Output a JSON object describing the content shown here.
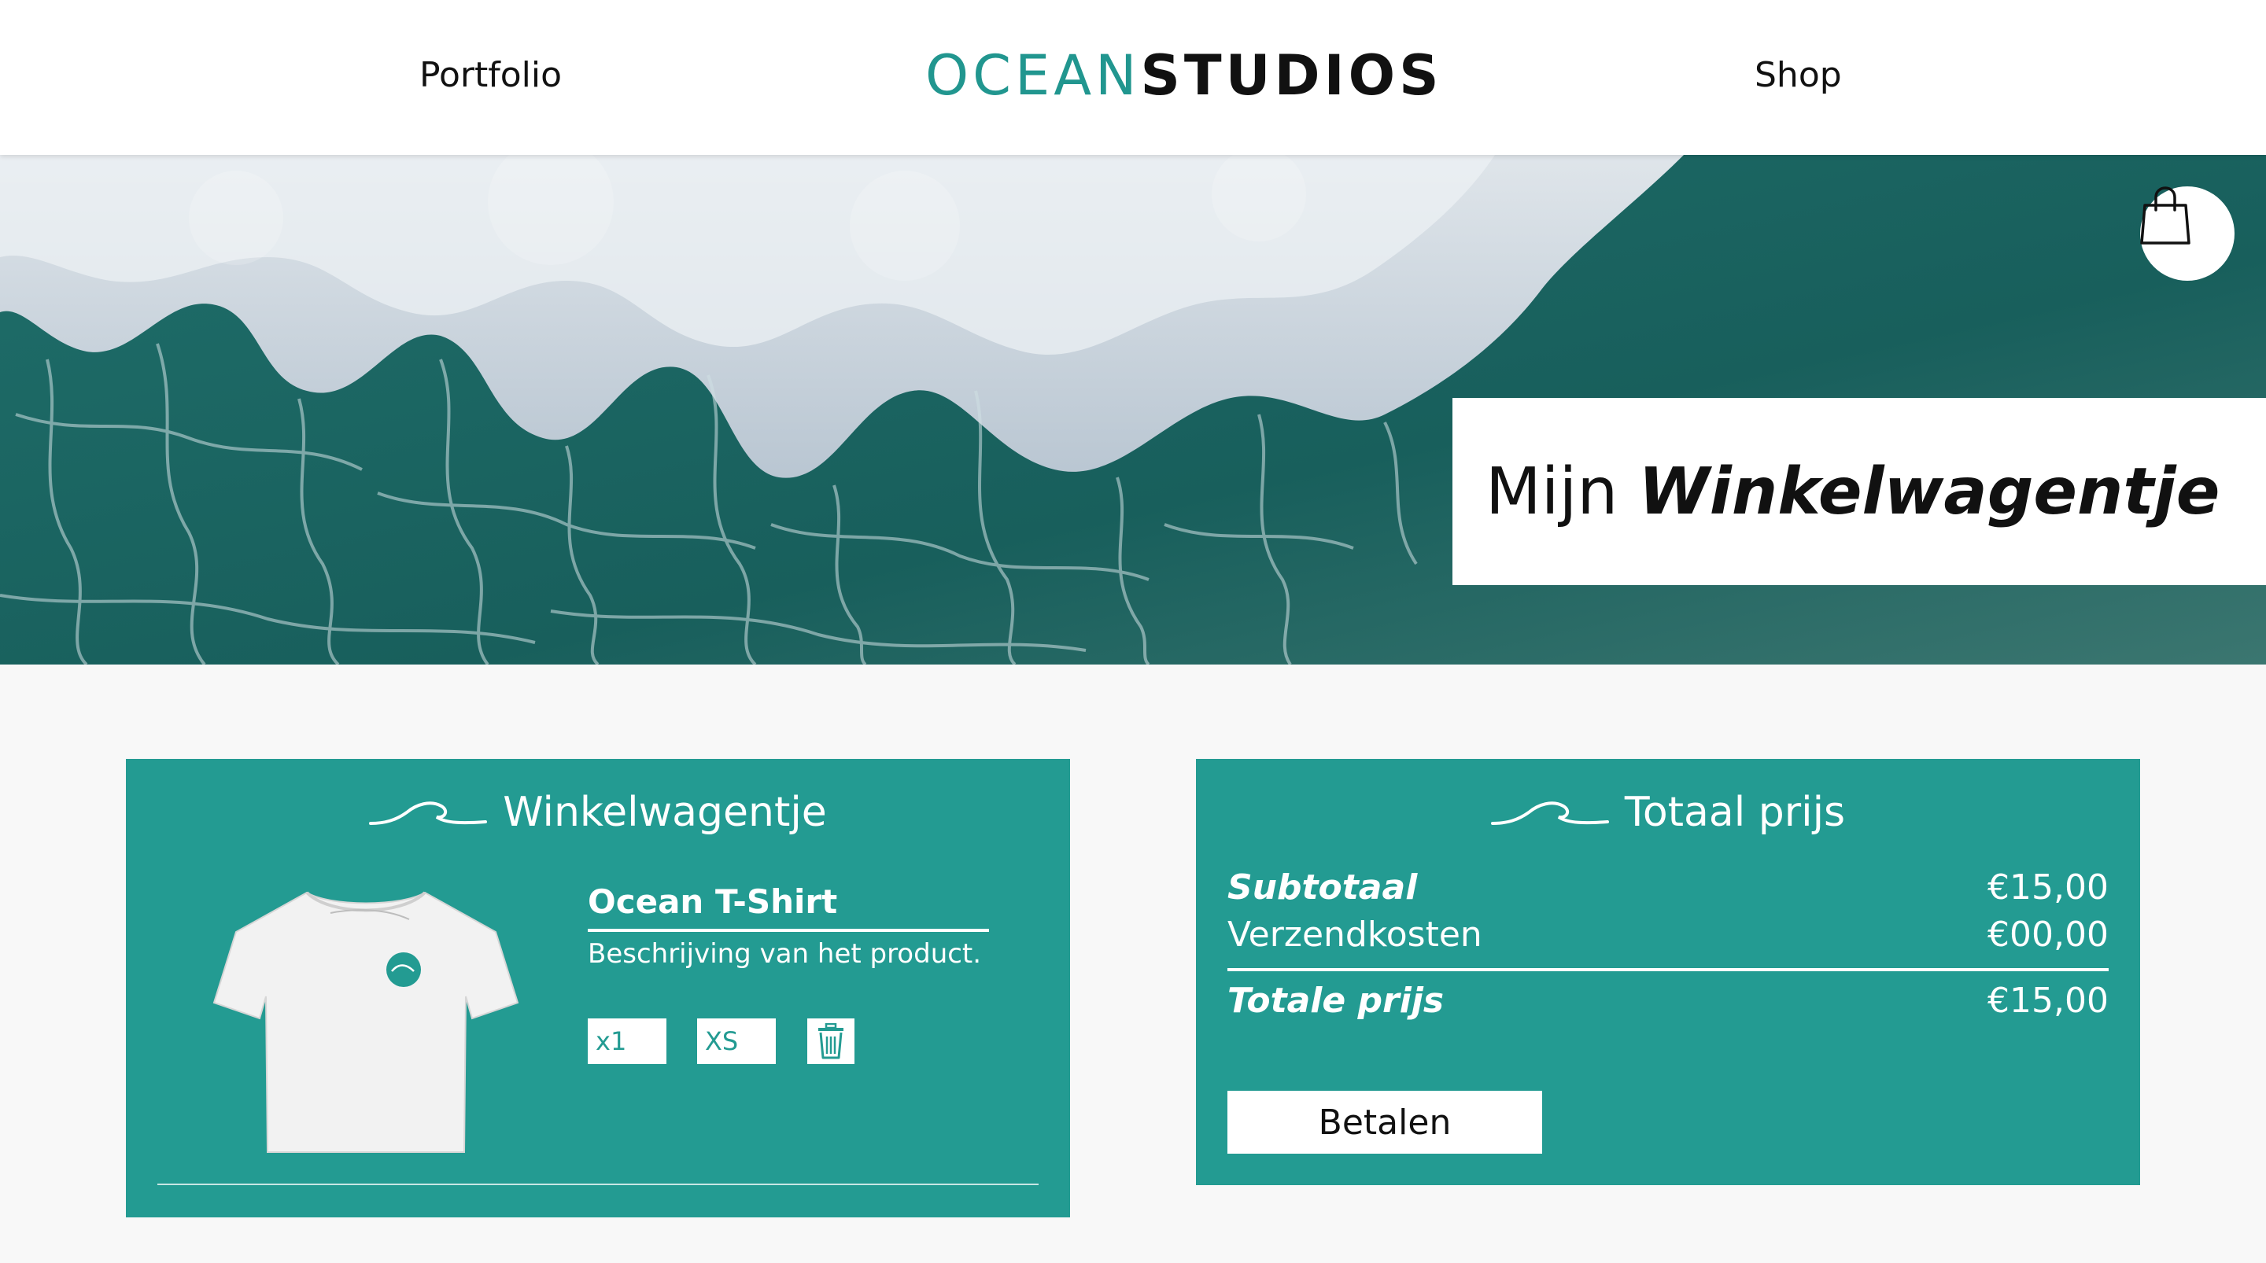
{
  "header": {
    "nav_left": "Portfolio",
    "nav_right": "Shop",
    "logo_part1": "OCEAN",
    "logo_part2": "STUDIOS"
  },
  "hero": {
    "title_regular": "Mijn ",
    "title_bold": "Winkelwagentje",
    "cart_icon": "shopping-bag-icon"
  },
  "cart": {
    "heading": "Winkelwagentje",
    "product": {
      "name": "Ocean T-Shirt",
      "description": "Beschrijving van het product.",
      "quantity": "x1",
      "size": "XS",
      "image": "tshirt-image",
      "delete_icon": "trash-icon"
    }
  },
  "totals": {
    "heading": "Totaal prijs",
    "subtotal_label": "Subtotaal",
    "subtotal_value": "€15,00",
    "shipping_label": "Verzendkosten",
    "shipping_value": "€00,00",
    "total_label": "Totale prijs",
    "total_value": "€15,00",
    "pay_label": "Betalen"
  },
  "colors": {
    "accent": "#239b92",
    "logo_teal": "#21968f",
    "background": "#f8f8f8"
  }
}
